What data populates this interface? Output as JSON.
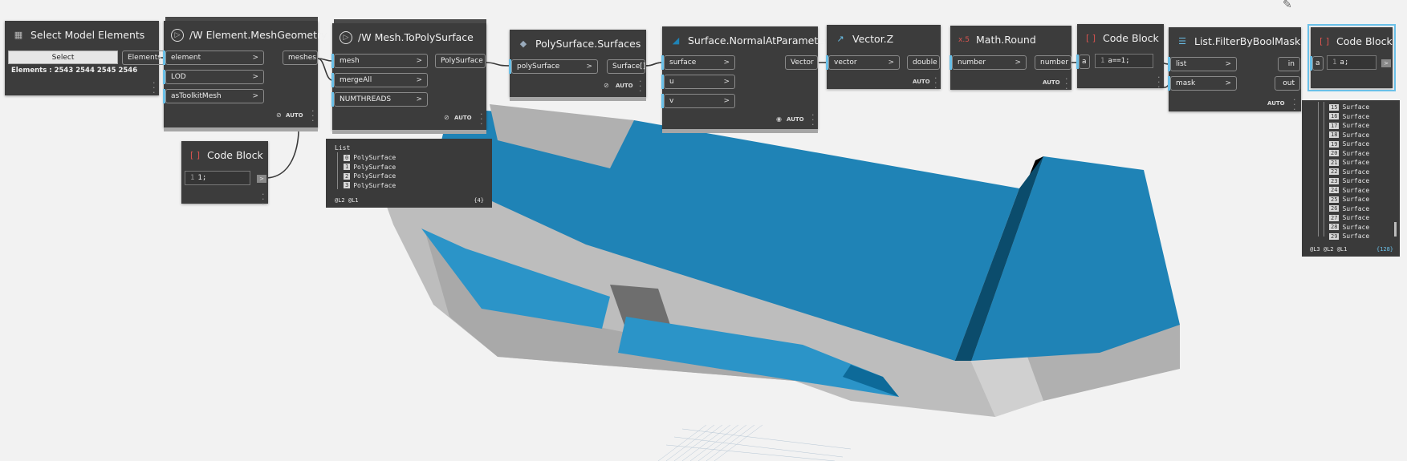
{
  "colors": {
    "surface_blue": "#1f83b6",
    "structure_grey": "#bdbdbd",
    "node_bg": "#3c3c3c",
    "select_outline": "#6ac0e8"
  },
  "nodes": {
    "select_model": {
      "title": "Select Model Elements",
      "icon": "select-elements-icon",
      "button": "Select",
      "output": "Elements",
      "summary": "Elements : 2543 2544 2545 2546"
    },
    "mesh_geometry": {
      "title": "Element.MeshGeometry",
      "prefix": "/W",
      "icon": "dynamo-package-icon",
      "inputs": [
        "element",
        "LOD",
        "asToolkitMesh"
      ],
      "output": "meshes",
      "lacing": "AUTO"
    },
    "code_block_1": {
      "title": "Code Block",
      "line": "1",
      "code": "1;",
      "output": ">"
    },
    "mesh_to_polysurface": {
      "title": "Mesh.ToPolySurface",
      "prefix": "/W",
      "icon": "dynamo-package-icon",
      "inputs": [
        "mesh",
        "mergeAll",
        "NUMTHREADS"
      ],
      "output": "PolySurface",
      "lacing": "AUTO"
    },
    "polysurface_preview": {
      "header": "List",
      "items": [
        {
          "idx": "0",
          "label": "PolySurface"
        },
        {
          "idx": "1",
          "label": "PolySurface"
        },
        {
          "idx": "2",
          "label": "PolySurface"
        },
        {
          "idx": "3",
          "label": "PolySurface"
        }
      ],
      "levels": "@L2 @L1",
      "count": "{4}"
    },
    "polysurface_surfaces": {
      "title": "PolySurface.Surfaces",
      "icon": "polysurface-icon",
      "input": "polySurface",
      "output": "Surface[]",
      "lacing": "AUTO"
    },
    "normal_at_parameter": {
      "title": "Surface.NormalAtParameter",
      "icon": "surface-normal-icon",
      "inputs": [
        "surface",
        "u",
        "v"
      ],
      "output": "Vector",
      "lacing": "AUTO"
    },
    "vector_z": {
      "title": "Vector.Z",
      "icon": "vector-icon",
      "input": "vector",
      "output": "double",
      "lacing": "AUTO"
    },
    "math_round": {
      "title": "Math.Round",
      "icon": "round-icon",
      "input": "number",
      "output": "number",
      "lacing": "AUTO"
    },
    "code_block_2": {
      "title": "Code Block",
      "input": "a",
      "line": "1",
      "code": "a==1;"
    },
    "filter_by_mask": {
      "title": "List.FilterByBoolMask",
      "icon": "list-filter-icon",
      "inputs": [
        "list",
        "mask"
      ],
      "outputs": [
        "in",
        "out"
      ],
      "lacing": "AUTO"
    },
    "code_block_3": {
      "title": "Code Block",
      "input": "a",
      "line": "1",
      "code": "a;",
      "output": ">"
    },
    "filter_preview": {
      "items": [
        {
          "idx": "15",
          "label": "Surface"
        },
        {
          "idx": "16",
          "label": "Surface"
        },
        {
          "idx": "17",
          "label": "Surface"
        },
        {
          "idx": "18",
          "label": "Surface"
        },
        {
          "idx": "19",
          "label": "Surface"
        },
        {
          "idx": "20",
          "label": "Surface"
        },
        {
          "idx": "21",
          "label": "Surface"
        },
        {
          "idx": "22",
          "label": "Surface"
        },
        {
          "idx": "23",
          "label": "Surface"
        },
        {
          "idx": "24",
          "label": "Surface"
        },
        {
          "idx": "25",
          "label": "Surface"
        },
        {
          "idx": "26",
          "label": "Surface"
        },
        {
          "idx": "27",
          "label": "Surface"
        },
        {
          "idx": "28",
          "label": "Surface"
        },
        {
          "idx": "29",
          "label": "Surface"
        }
      ],
      "levels": "@L3 @L2 @L1",
      "count": "{128}"
    }
  }
}
